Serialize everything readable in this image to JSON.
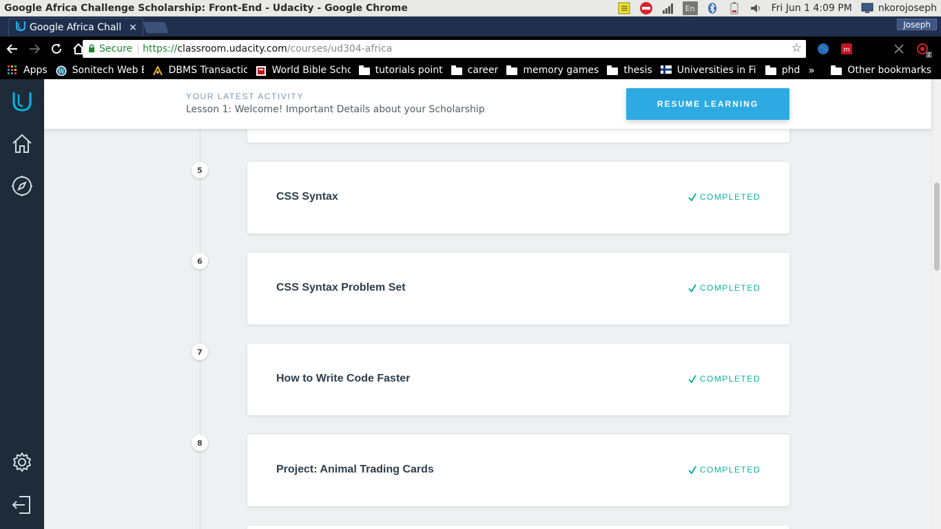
{
  "os": {
    "window_title": "Google Africa Challenge Scholarship: Front-End - Udacity - Google Chrome",
    "keyboard_layout": "En",
    "datetime": "Fri Jun  1  4:09 PM",
    "username": "nkorojoseph"
  },
  "browser": {
    "tab_title": "Google Africa Chall",
    "tab_close": "×",
    "profile_name": "Joseph",
    "secure_label": "Secure",
    "url_scheme": "https://",
    "url_host": "classroom.udacity.com",
    "url_path": "/courses/ud304-africa",
    "extension_badge": "2"
  },
  "bookmarks": {
    "items": [
      {
        "label": "Apps",
        "icon": "apps-grid-icon"
      },
      {
        "label": "Sonitech Web Bl",
        "icon": "wordpress-icon"
      },
      {
        "label": "DBMS Transactic",
        "icon": "site-icon"
      },
      {
        "label": "World Bible Scho",
        "icon": "site-icon"
      },
      {
        "label": "tutorials point",
        "icon": "folder-icon"
      },
      {
        "label": "career",
        "icon": "folder-icon"
      },
      {
        "label": "memory games",
        "icon": "folder-icon"
      },
      {
        "label": "thesis",
        "icon": "folder-icon"
      },
      {
        "label": "Universities in Fi",
        "icon": "finland-flag-icon"
      },
      {
        "label": "phd",
        "icon": "folder-icon"
      }
    ],
    "overflow": "»",
    "other": "Other bookmarks"
  },
  "activity": {
    "eyebrow": "YOUR LATEST ACTIVITY",
    "lesson": "Lesson 1: Welcome! Important Details about your Scholarship",
    "resume_label": "RESUME LEARNING"
  },
  "lessons": [
    {
      "number": "5",
      "title": "CSS Syntax",
      "status": "COMPLETED"
    },
    {
      "number": "6",
      "title": "CSS Syntax Problem Set",
      "status": "COMPLETED"
    },
    {
      "number": "7",
      "title": "How to Write Code Faster",
      "status": "COMPLETED"
    },
    {
      "number": "8",
      "title": "Project: Animal Trading Cards",
      "status": "COMPLETED"
    }
  ],
  "colors": {
    "brand": "#02b3e4",
    "completed": "#02b3a1",
    "rail": "#1e2b38"
  }
}
